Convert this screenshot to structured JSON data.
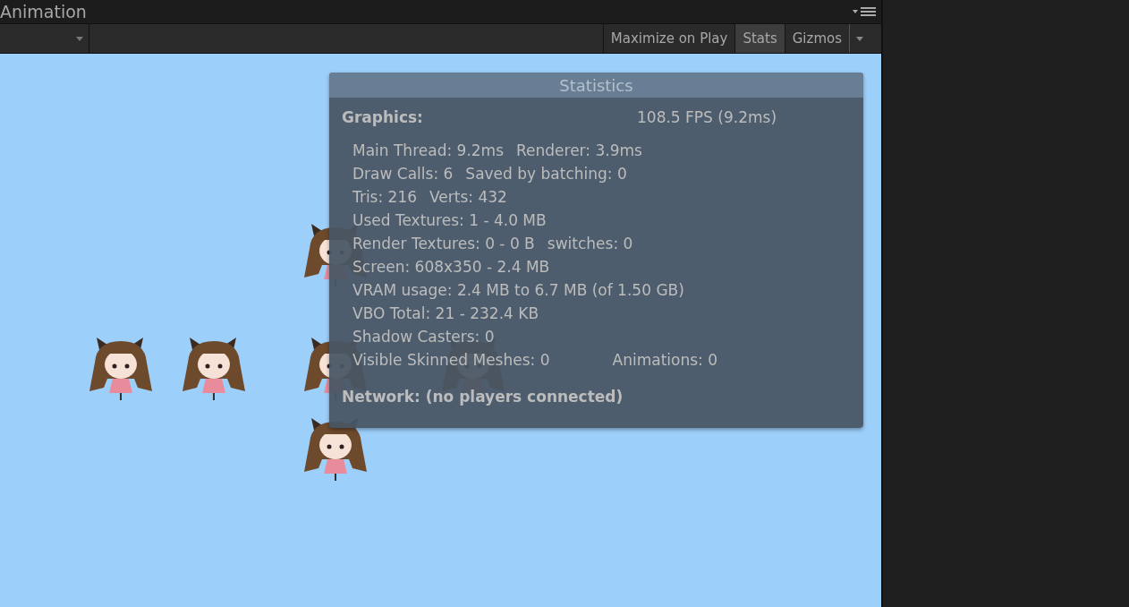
{
  "window": {
    "title": "Animation"
  },
  "toolbar": {
    "buttons": [
      {
        "label": "Maximize on Play",
        "selected": false
      },
      {
        "label": "Stats",
        "selected": true
      },
      {
        "label": "Gizmos",
        "selected": false
      }
    ]
  },
  "statistics": {
    "title": "Statistics",
    "graphics_label": "Graphics:",
    "fps": "108.5 FPS (9.2ms)",
    "lines": [
      [
        "Main Thread: 9.2ms",
        "Renderer: 3.9ms"
      ],
      [
        "Draw Calls: 6",
        "Saved by batching: 0"
      ],
      [
        "Tris: 216",
        "Verts: 432"
      ],
      [
        "Used Textures: 1 - 4.0 MB"
      ],
      [
        "Render Textures: 0 - 0 B",
        "switches: 0"
      ],
      [
        "Screen: 608x350 - 2.4 MB"
      ],
      [
        "VRAM usage: 2.4 MB to 6.7 MB (of 1.50 GB)"
      ],
      [
        "VBO Total: 21 - 232.4 KB"
      ],
      [
        "Shadow Casters: 0"
      ],
      [
        "Visible Skinned Meshes: 0",
        "Animations: 0"
      ]
    ],
    "network": "Network: (no players connected)"
  }
}
